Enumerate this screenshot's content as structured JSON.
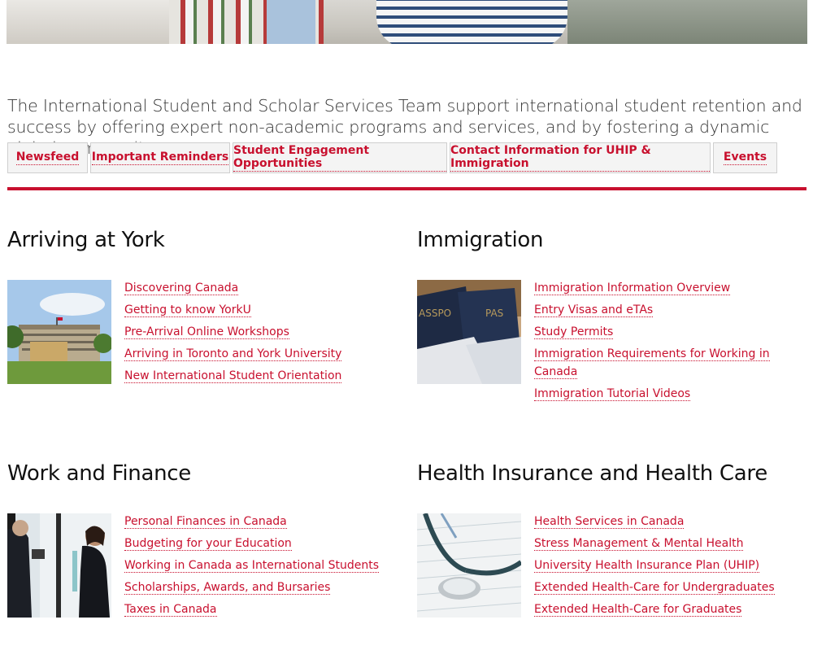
{
  "intro": "The International Student and Scholar Services Team support international student retention and success by offering expert non-academic programs and services, and by fostering a dynamic global community.",
  "tabs": [
    "Newsfeed",
    "Important Reminders",
    "Student Engagement Opportunities",
    "Contact Information for UHIP & Immigration",
    "Events"
  ],
  "sections": {
    "arriving": {
      "title": "Arriving at York",
      "links": [
        "Discovering Canada",
        "Getting to know YorkU",
        "Pre-Arrival Online Workshops",
        "Arriving in Toronto and York University",
        "New International Student Orientation"
      ]
    },
    "immigration": {
      "title": "Immigration",
      "links": [
        "Immigration Information Overview",
        "Entry Visas and eTAs",
        "Study Permits",
        "Immigration Requirements for Working in Canada",
        "Immigration Tutorial Videos"
      ]
    },
    "work": {
      "title": "Work and Finance",
      "links": [
        "Personal Finances in Canada",
        "Budgeting for your Education",
        "Working in Canada as International Students",
        "Scholarships, Awards, and Bursaries",
        "Taxes in Canada"
      ]
    },
    "health": {
      "title": "Health Insurance and Health Care",
      "links": [
        "Health Services in Canada",
        "Stress Management & Mental Health",
        "University Health Insurance Plan (UHIP)",
        "Extended Health-Care for Undergraduates",
        "Extended Health-Care for Graduates"
      ]
    }
  },
  "colors": {
    "accent": "#c8102e",
    "tab_bg": "#f4f4f4",
    "text": "#111111"
  }
}
